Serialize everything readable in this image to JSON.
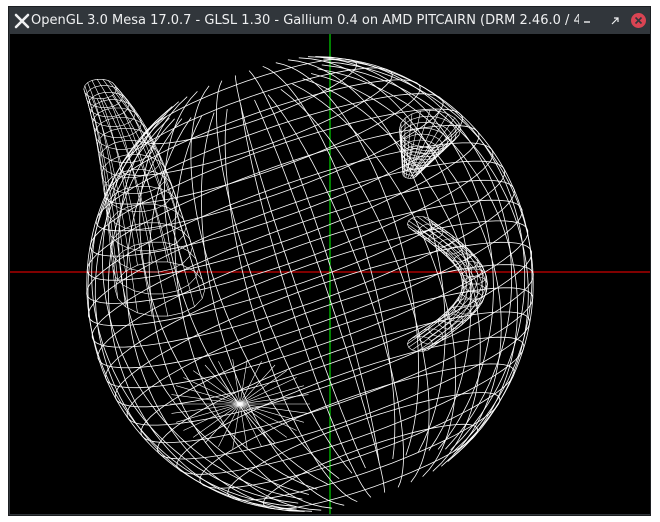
{
  "window": {
    "title": "OpenGL 3.0 Mesa 17.0.7 - GLSL 1.30 - Gallium 0.4 on AMD PITCAIRN (DRM 2.46.0 / 4.8.0-...",
    "icons": {
      "app": "x-logo-icon",
      "minimize": "minimize-icon",
      "maximize": "restore-icon",
      "close": "close-icon"
    }
  },
  "viewport": {
    "background": "#000000",
    "wire_color": "#ffffff",
    "x_axis_color": "#ff0000",
    "y_axis_color": "#00ff00",
    "model": "teapot-wireframe"
  }
}
